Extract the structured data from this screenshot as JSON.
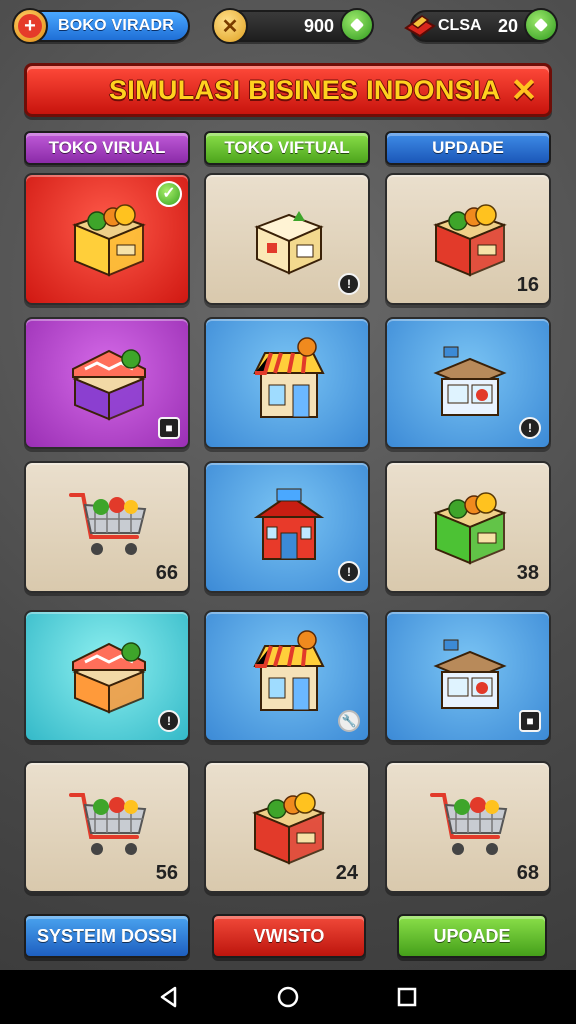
{
  "topbar": {
    "left_label": "BOKO VIRADR",
    "coins_value": "900",
    "right_label": "CLSA",
    "right_value": "20"
  },
  "title": "SIMULASI BISINES INDONSIA",
  "tabs": [
    {
      "label": "TOKO VIRUAL"
    },
    {
      "label": "TOKO VIFTUAL"
    },
    {
      "label": "UPDADE"
    }
  ],
  "tiles": [
    {
      "kind": "crate",
      "bg": "red",
      "badge": "check",
      "number": "",
      "icon": "vegetable-crate-icon"
    },
    {
      "kind": "box",
      "bg": "beige",
      "badge": "circle",
      "number": "",
      "icon": "open-box-icon"
    },
    {
      "kind": "crate",
      "bg": "beige",
      "badge": "",
      "number": "16",
      "icon": "fruit-crate-icon"
    },
    {
      "kind": "stall",
      "bg": "purple",
      "badge": "square",
      "number": "",
      "icon": "market-stall-icon"
    },
    {
      "kind": "shop",
      "bg": "blue",
      "badge": "",
      "number": "",
      "icon": "shop-icon"
    },
    {
      "kind": "kiosk",
      "bg": "blue",
      "badge": "circle",
      "number": "",
      "icon": "kiosk-icon"
    },
    {
      "kind": "cart",
      "bg": "beige",
      "badge": "",
      "number": "66",
      "icon": "shopping-cart-icon"
    },
    {
      "kind": "house",
      "bg": "blue",
      "badge": "circle",
      "number": "",
      "icon": "store-house-icon"
    },
    {
      "kind": "crate",
      "bg": "beige",
      "badge": "",
      "number": "38",
      "icon": "green-crate-icon"
    },
    {
      "kind": "stall",
      "bg": "teal",
      "badge": "circle",
      "number": "",
      "icon": "fruit-stall-icon"
    },
    {
      "kind": "shop",
      "bg": "blue",
      "badge": "tool",
      "number": "",
      "icon": "fruit-shop-icon"
    },
    {
      "kind": "kiosk",
      "bg": "blue",
      "badge": "square",
      "number": "",
      "icon": "mini-market-icon"
    },
    {
      "kind": "cart",
      "bg": "beige",
      "badge": "",
      "number": "56",
      "icon": "vegetable-cart-icon"
    },
    {
      "kind": "crate",
      "bg": "beige",
      "badge": "",
      "number": "24",
      "icon": "red-crate-icon"
    },
    {
      "kind": "cart",
      "bg": "beige",
      "badge": "",
      "number": "68",
      "icon": "grocery-cart-icon"
    }
  ],
  "buttons": {
    "left": "SYSTEIM DOSSI",
    "middle": "VWISTO",
    "right": "UPOADE"
  },
  "colors": {
    "red": "#d01812",
    "blue": "#3c8ad6",
    "green": "#4ca41c",
    "purple": "#9a2fb4",
    "gold": "#ffd21f"
  }
}
